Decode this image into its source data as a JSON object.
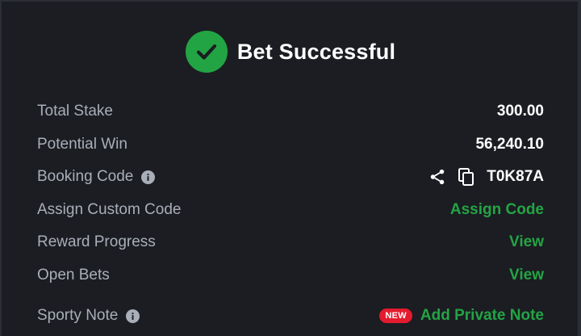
{
  "header": {
    "title": "Bet Successful",
    "icon": "check-icon"
  },
  "rows": {
    "total_stake": {
      "label": "Total Stake",
      "value": "300.00"
    },
    "potential_win": {
      "label": "Potential Win",
      "value": "56,240.10"
    },
    "booking_code": {
      "label": "Booking Code",
      "value": "T0K87A",
      "icons": [
        "info-icon",
        "share-icon",
        "copy-icon"
      ]
    },
    "assign_custom_code": {
      "label": "Assign Custom Code",
      "link": "Assign Code"
    },
    "reward_progress": {
      "label": "Reward Progress",
      "link": "View"
    },
    "open_bets": {
      "label": "Open Bets",
      "link": "View"
    },
    "sporty_note": {
      "label": "Sporty Note",
      "badge": "NEW",
      "link": "Add Private Note"
    }
  },
  "colors": {
    "background": "#1b1d22",
    "accent_green": "#23a444",
    "badge_red": "#e41b2e",
    "label_gray": "#a9aeb8",
    "value_white": "#ffffff"
  }
}
